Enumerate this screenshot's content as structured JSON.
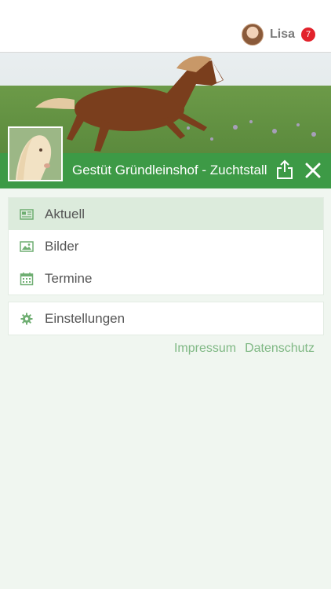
{
  "user": {
    "name": "Lisa",
    "notifications": "7"
  },
  "page": {
    "title": "Gestüt Gründleinshof - Zuchtstall"
  },
  "nav": {
    "items": [
      {
        "label": "Aktuell",
        "icon": "news-icon",
        "active": true
      },
      {
        "label": "Bilder",
        "icon": "image-icon"
      },
      {
        "label": "Termine",
        "icon": "calendar-icon"
      }
    ],
    "settings": {
      "label": "Einstellungen",
      "icon": "gear-icon"
    }
  },
  "footer_links": {
    "impressum": "Impressum",
    "datenschutz": "Datenschutz"
  },
  "colors": {
    "accent": "#3d9a46",
    "badge": "#e2222b",
    "link": "#7fb884"
  }
}
